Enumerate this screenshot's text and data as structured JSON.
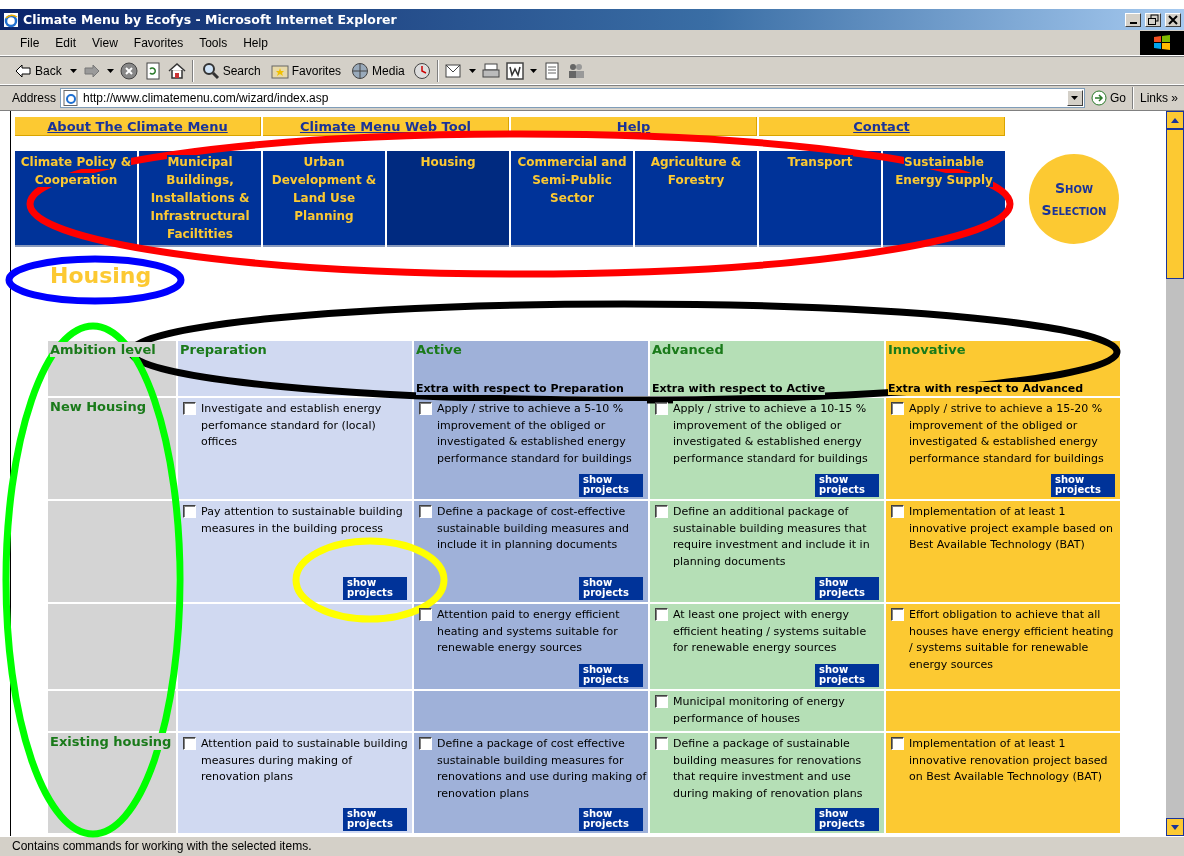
{
  "window": {
    "title": "Climate Menu by Ecofys - Microsoft Internet Explorer"
  },
  "menu": [
    "File",
    "Edit",
    "View",
    "Favorites",
    "Tools",
    "Help"
  ],
  "toolbar": [
    {
      "label": "Back",
      "dropdown": true
    },
    {
      "dropdown": true
    },
    {
      "dropdown": false
    },
    {
      "dropdown": false
    },
    {
      "dropdown": false
    },
    {
      "label": "Search",
      "dropdown": false
    },
    {
      "label": "Favorites",
      "dropdown": false
    },
    {
      "label": "Media",
      "dropdown": false
    },
    {
      "dropdown": false
    },
    {
      "dropdown": true
    },
    {
      "dropdown": false
    },
    {
      "dropdown": true
    },
    {
      "dropdown": false
    },
    {
      "dropdown": false
    }
  ],
  "address": {
    "label": "Address",
    "value": "http://www.climatemenu.com/wizard/index.asp",
    "go": "Go",
    "links": "Links",
    "links_more": "»"
  },
  "top_nav": [
    "About The Climate Menu",
    "Climate Menu Web Tool",
    "Help",
    "Contact"
  ],
  "categories": [
    {
      "label": "Climate Policy & Cooperation",
      "selected": false
    },
    {
      "label": "Municipal Buildings, Installations & Infrastructural Faciltities",
      "selected": false
    },
    {
      "label": "Urban Development & Land Use Planning",
      "selected": false
    },
    {
      "label": "Housing",
      "selected": true
    },
    {
      "label": "Commercial and Semi-Public Sector",
      "selected": false
    },
    {
      "label": "Agriculture & Forestry",
      "selected": false
    },
    {
      "label": "Transport",
      "selected": false
    },
    {
      "label": "Sustainable Energy Supply",
      "selected": false
    }
  ],
  "show_selection": "Show Selection",
  "heading": "Housing",
  "table": {
    "columns": [
      {
        "title": "Ambition level",
        "color": "#d4d4d4"
      },
      {
        "title": "Preparation",
        "color": "#d0d9f1"
      },
      {
        "title": "Active",
        "subtitle": "Extra with respect to Preparation",
        "color": "#9fb1d9"
      },
      {
        "title": "Advanced",
        "subtitle": "Extra with respect to Active",
        "color": "#b5dfb6"
      },
      {
        "title": "Innovative",
        "subtitle": "Extra with respect to Advanced",
        "color": "#fcc932"
      }
    ],
    "rows": [
      {
        "cells": [
          "New Housing",
          {
            "text": "Investigate and establish energy perfomance standard for (local) offices",
            "checked": false
          },
          {
            "text": "Apply / strive to achieve a 5-10 % improvement of the obliged or investigated & established energy performance standard for buildings",
            "checked": false,
            "button": "show projects"
          },
          {
            "text": "Apply / strive to achieve a 10-15 % improvement of the obliged or investigated & established energy performance standard for buildings",
            "checked": false,
            "button": "show projects"
          },
          {
            "text": "Apply / strive to achieve a 15-20 % improvement of the obliged or investigated & established energy performance standard for buildings",
            "checked": false,
            "button": "show projects"
          }
        ]
      },
      {
        "cells": [
          "",
          {
            "text": "Pay attention to sustainable building measures in the building process",
            "checked": false,
            "button": "show projects"
          },
          {
            "text": "Define a package of cost-effective sustainable building measures and include it in planning documents",
            "checked": false,
            "button": "show projects"
          },
          {
            "text": "Define an additional package of sustainable building measures that require investment and include it in planning documents",
            "checked": false,
            "button": "show projects"
          },
          {
            "text": "Implementation of at least 1 innovative project example based on Best Available Technology (BAT)",
            "checked": false
          }
        ]
      },
      {
        "cells": [
          "",
          "",
          {
            "text": "Attention paid to energy efficient heating and systems suitable for renewable energy sources",
            "checked": false,
            "button": "show projects"
          },
          {
            "text": "At least one project with energy efficient heating / systems suitable for renewable energy sources",
            "checked": false,
            "button": "show projects"
          },
          {
            "text": "Effort obligation to achieve that all houses have energy efficient heating / systems suitable for renewable energy sources",
            "checked": false
          }
        ]
      },
      {
        "cells": [
          "",
          "",
          "",
          {
            "text": "Municipal monitoring of energy performance of houses",
            "checked": false
          },
          ""
        ]
      },
      {
        "cells": [
          "Existing housing",
          {
            "text": "Attention paid to sustainable building measures during making of renovation plans",
            "checked": false,
            "button": "show projects"
          },
          {
            "text": "Define a package of cost effective sustainable building measures for renovations and use during making of renovation plans",
            "checked": false,
            "button": "show projects"
          },
          {
            "text": "Define a package of sustainable building measures for renovations that require investment and use during making of renovation plans",
            "checked": false,
            "button": "show projects"
          },
          {
            "text": "Implementation of at least 1 innovative renovation project based on Best Available Technology (BAT)",
            "checked": false
          }
        ]
      }
    ]
  },
  "annotations": [
    {
      "color": "#ff0000"
    },
    {
      "color": "#0000ff"
    },
    {
      "color": "#000000"
    },
    {
      "color": "#00ff00"
    },
    {
      "color": "#ffff00"
    }
  ],
  "status_bar": "Contains commands for working with the selected items."
}
